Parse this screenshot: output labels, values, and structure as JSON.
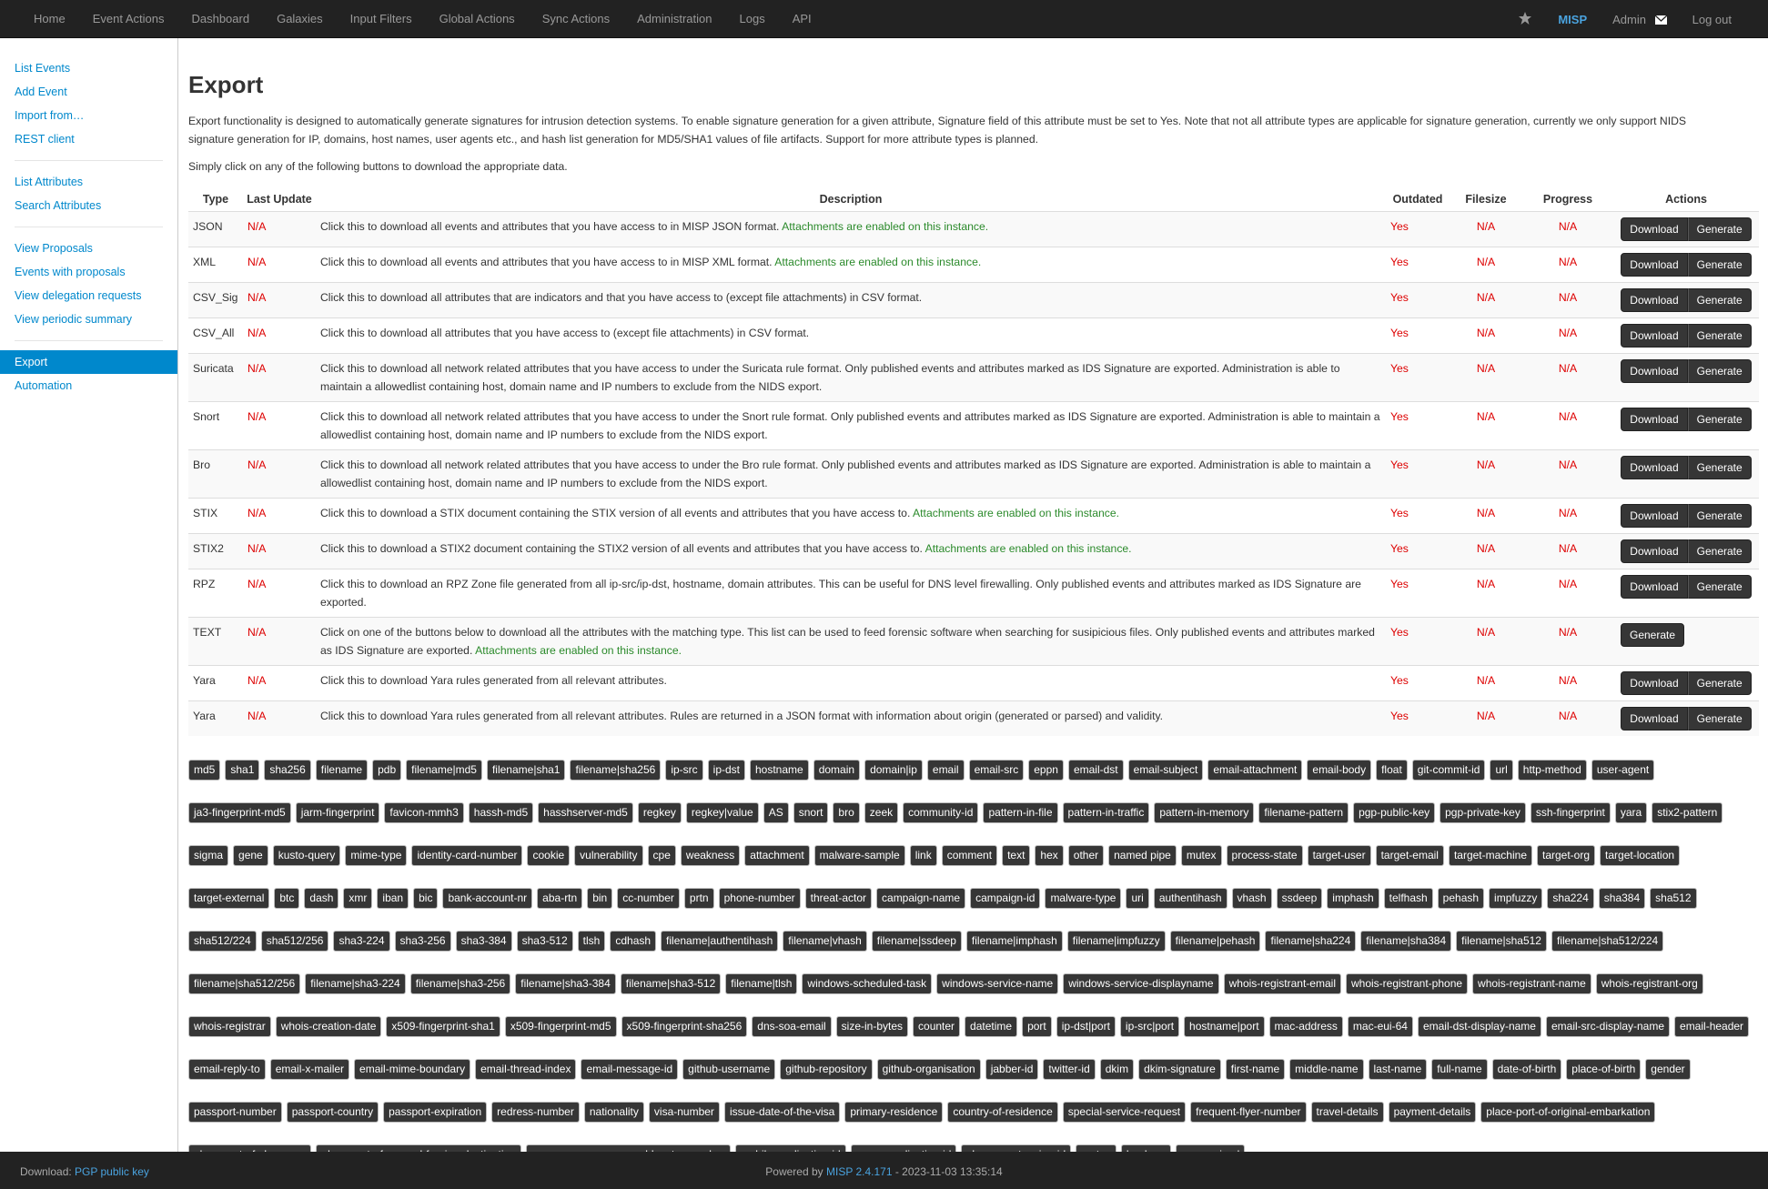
{
  "nav": {
    "items": [
      "Home",
      "Event Actions",
      "Dashboard",
      "Galaxies",
      "Input Filters",
      "Global Actions",
      "Sync Actions",
      "Administration",
      "Logs",
      "API"
    ],
    "brand": "MISP",
    "user": "Admin",
    "logout": "Log out"
  },
  "sidebar": {
    "groups": [
      [
        "List Events",
        "Add Event",
        "Import from…",
        "REST client"
      ],
      [
        "List Attributes",
        "Search Attributes"
      ],
      [
        "View Proposals",
        "Events with proposals",
        "View delegation requests",
        "View periodic summary"
      ],
      [
        "Export",
        "Automation"
      ]
    ],
    "active": "Export"
  },
  "page": {
    "title": "Export",
    "intro": "Export functionality is designed to automatically generate signatures for intrusion detection systems. To enable signature generation for a given attribute, Signature field of this attribute must be set to Yes. Note that not all attribute types are applicable for signature generation, currently we only support NIDS signature generation for IP, domains, host names, user agents etc., and hash list generation for MD5/SHA1 values of file artifacts. Support for more attribute types is planned.",
    "hint": "Simply click on any of the following buttons to download the appropriate data."
  },
  "table": {
    "headers": [
      "Type",
      "Last Update",
      "Description",
      "Outdated",
      "Filesize",
      "Progress",
      "Actions"
    ],
    "download_label": "Download",
    "generate_label": "Generate",
    "rows": [
      {
        "type": "JSON",
        "last_update": "N/A",
        "desc": "Click this to download all events and attributes that you have access to in MISP JSON format.",
        "note": "Attachments are enabled on this instance.",
        "outdated": "Yes",
        "filesize": "N/A",
        "progress": "N/A",
        "download": true
      },
      {
        "type": "XML",
        "last_update": "N/A",
        "desc": "Click this to download all events and attributes that you have access to in MISP XML format.",
        "note": "Attachments are enabled on this instance.",
        "outdated": "Yes",
        "filesize": "N/A",
        "progress": "N/A",
        "download": true
      },
      {
        "type": "CSV_Sig",
        "last_update": "N/A",
        "desc": "Click this to download all attributes that are indicators and that you have access to (except file attachments) in CSV format.",
        "note": "",
        "outdated": "Yes",
        "filesize": "N/A",
        "progress": "N/A",
        "download": true
      },
      {
        "type": "CSV_All",
        "last_update": "N/A",
        "desc": "Click this to download all attributes that you have access to (except file attachments) in CSV format.",
        "note": "",
        "outdated": "Yes",
        "filesize": "N/A",
        "progress": "N/A",
        "download": true
      },
      {
        "type": "Suricata",
        "last_update": "N/A",
        "desc": "Click this to download all network related attributes that you have access to under the Suricata rule format. Only published events and attributes marked as IDS Signature are exported. Administration is able to maintain a allowedlist containing host, domain name and IP numbers to exclude from the NIDS export.",
        "note": "",
        "outdated": "Yes",
        "filesize": "N/A",
        "progress": "N/A",
        "download": true
      },
      {
        "type": "Snort",
        "last_update": "N/A",
        "desc": "Click this to download all network related attributes that you have access to under the Snort rule format. Only published events and attributes marked as IDS Signature are exported. Administration is able to maintain a allowedlist containing host, domain name and IP numbers to exclude from the NIDS export.",
        "note": "",
        "outdated": "Yes",
        "filesize": "N/A",
        "progress": "N/A",
        "download": true
      },
      {
        "type": "Bro",
        "last_update": "N/A",
        "desc": "Click this to download all network related attributes that you have access to under the Bro rule format. Only published events and attributes marked as IDS Signature are exported. Administration is able to maintain a allowedlist containing host, domain name and IP numbers to exclude from the NIDS export.",
        "note": "",
        "outdated": "Yes",
        "filesize": "N/A",
        "progress": "N/A",
        "download": true
      },
      {
        "type": "STIX",
        "last_update": "N/A",
        "desc": "Click this to download a STIX document containing the STIX version of all events and attributes that you have access to.",
        "note": "Attachments are enabled on this instance.",
        "outdated": "Yes",
        "filesize": "N/A",
        "progress": "N/A",
        "download": true
      },
      {
        "type": "STIX2",
        "last_update": "N/A",
        "desc": "Click this to download a STIX2 document containing the STIX2 version of all events and attributes that you have access to.",
        "note": "Attachments are enabled on this instance.",
        "outdated": "Yes",
        "filesize": "N/A",
        "progress": "N/A",
        "download": true
      },
      {
        "type": "RPZ",
        "last_update": "N/A",
        "desc": "Click this to download an RPZ Zone file generated from all ip-src/ip-dst, hostname, domain attributes. This can be useful for DNS level firewalling. Only published events and attributes marked as IDS Signature are exported.",
        "note": "",
        "outdated": "Yes",
        "filesize": "N/A",
        "progress": "N/A",
        "download": true
      },
      {
        "type": "TEXT",
        "last_update": "N/A",
        "desc": "Click on one of the buttons below to download all the attributes with the matching type. This list can be used to feed forensic software when searching for susipicious files. Only published events and attributes marked as IDS Signature are exported.",
        "note": "Attachments are enabled on this instance.",
        "outdated": "Yes",
        "filesize": "N/A",
        "progress": "N/A",
        "download": false
      },
      {
        "type": "Yara",
        "last_update": "N/A",
        "desc": "Click this to download Yara rules generated from all relevant attributes.",
        "note": "",
        "outdated": "Yes",
        "filesize": "N/A",
        "progress": "N/A",
        "download": true
      },
      {
        "type": "Yara",
        "last_update": "N/A",
        "desc": "Click this to download Yara rules generated from all relevant attributes. Rules are returned in a JSON format with information about origin (generated or parsed) and validity.",
        "note": "",
        "outdated": "Yes",
        "filesize": "N/A",
        "progress": "N/A",
        "download": true
      }
    ]
  },
  "tags": [
    "md5",
    "sha1",
    "sha256",
    "filename",
    "pdb",
    "filename|md5",
    "filename|sha1",
    "filename|sha256",
    "ip-src",
    "ip-dst",
    "hostname",
    "domain",
    "domain|ip",
    "email",
    "email-src",
    "eppn",
    "email-dst",
    "email-subject",
    "email-attachment",
    "email-body",
    "float",
    "git-commit-id",
    "url",
    "http-method",
    "user-agent",
    "ja3-fingerprint-md5",
    "jarm-fingerprint",
    "favicon-mmh3",
    "hassh-md5",
    "hasshserver-md5",
    "regkey",
    "regkey|value",
    "AS",
    "snort",
    "bro",
    "zeek",
    "community-id",
    "pattern-in-file",
    "pattern-in-traffic",
    "pattern-in-memory",
    "filename-pattern",
    "pgp-public-key",
    "pgp-private-key",
    "ssh-fingerprint",
    "yara",
    "stix2-pattern",
    "sigma",
    "gene",
    "kusto-query",
    "mime-type",
    "identity-card-number",
    "cookie",
    "vulnerability",
    "cpe",
    "weakness",
    "attachment",
    "malware-sample",
    "link",
    "comment",
    "text",
    "hex",
    "other",
    "named pipe",
    "mutex",
    "process-state",
    "target-user",
    "target-email",
    "target-machine",
    "target-org",
    "target-location",
    "target-external",
    "btc",
    "dash",
    "xmr",
    "iban",
    "bic",
    "bank-account-nr",
    "aba-rtn",
    "bin",
    "cc-number",
    "prtn",
    "phone-number",
    "threat-actor",
    "campaign-name",
    "campaign-id",
    "malware-type",
    "uri",
    "authentihash",
    "vhash",
    "ssdeep",
    "imphash",
    "telfhash",
    "pehash",
    "impfuzzy",
    "sha224",
    "sha384",
    "sha512",
    "sha512/224",
    "sha512/256",
    "sha3-224",
    "sha3-256",
    "sha3-384",
    "sha3-512",
    "tlsh",
    "cdhash",
    "filename|authentihash",
    "filename|vhash",
    "filename|ssdeep",
    "filename|imphash",
    "filename|impfuzzy",
    "filename|pehash",
    "filename|sha224",
    "filename|sha384",
    "filename|sha512",
    "filename|sha512/224",
    "filename|sha512/256",
    "filename|sha3-224",
    "filename|sha3-256",
    "filename|sha3-384",
    "filename|sha3-512",
    "filename|tlsh",
    "windows-scheduled-task",
    "windows-service-name",
    "windows-service-displayname",
    "whois-registrant-email",
    "whois-registrant-phone",
    "whois-registrant-name",
    "whois-registrant-org",
    "whois-registrar",
    "whois-creation-date",
    "x509-fingerprint-sha1",
    "x509-fingerprint-md5",
    "x509-fingerprint-sha256",
    "dns-soa-email",
    "size-in-bytes",
    "counter",
    "datetime",
    "port",
    "ip-dst|port",
    "ip-src|port",
    "hostname|port",
    "mac-address",
    "mac-eui-64",
    "email-dst-display-name",
    "email-src-display-name",
    "email-header",
    "email-reply-to",
    "email-x-mailer",
    "email-mime-boundary",
    "email-thread-index",
    "email-message-id",
    "github-username",
    "github-repository",
    "github-organisation",
    "jabber-id",
    "twitter-id",
    "dkim",
    "dkim-signature",
    "first-name",
    "middle-name",
    "last-name",
    "full-name",
    "date-of-birth",
    "place-of-birth",
    "gender",
    "passport-number",
    "passport-country",
    "passport-expiration",
    "redress-number",
    "nationality",
    "visa-number",
    "issue-date-of-the-visa",
    "primary-residence",
    "country-of-residence",
    "special-service-request",
    "frequent-flyer-number",
    "travel-details",
    "payment-details",
    "place-port-of-original-embarkation",
    "place-port-of-clearance",
    "place-port-of-onward-foreign-destination",
    "passenger-name-record-locator-number",
    "mobile-application-id",
    "azure-application-id",
    "chrome-extension-id",
    "cortex",
    "boolean",
    "anonymised"
  ],
  "footer": {
    "download_prefix": "Download:",
    "download_link": "PGP public key",
    "powered_prefix": "Powered by",
    "powered_link": "MISP 2.4.171",
    "powered_suffix": "- 2023-11-03 13:35:14"
  },
  "colors": {
    "accent": "#0088cc",
    "navbar": "#222222",
    "button": "#363636",
    "red": "#dd0000",
    "green": "#2b8a2b"
  }
}
